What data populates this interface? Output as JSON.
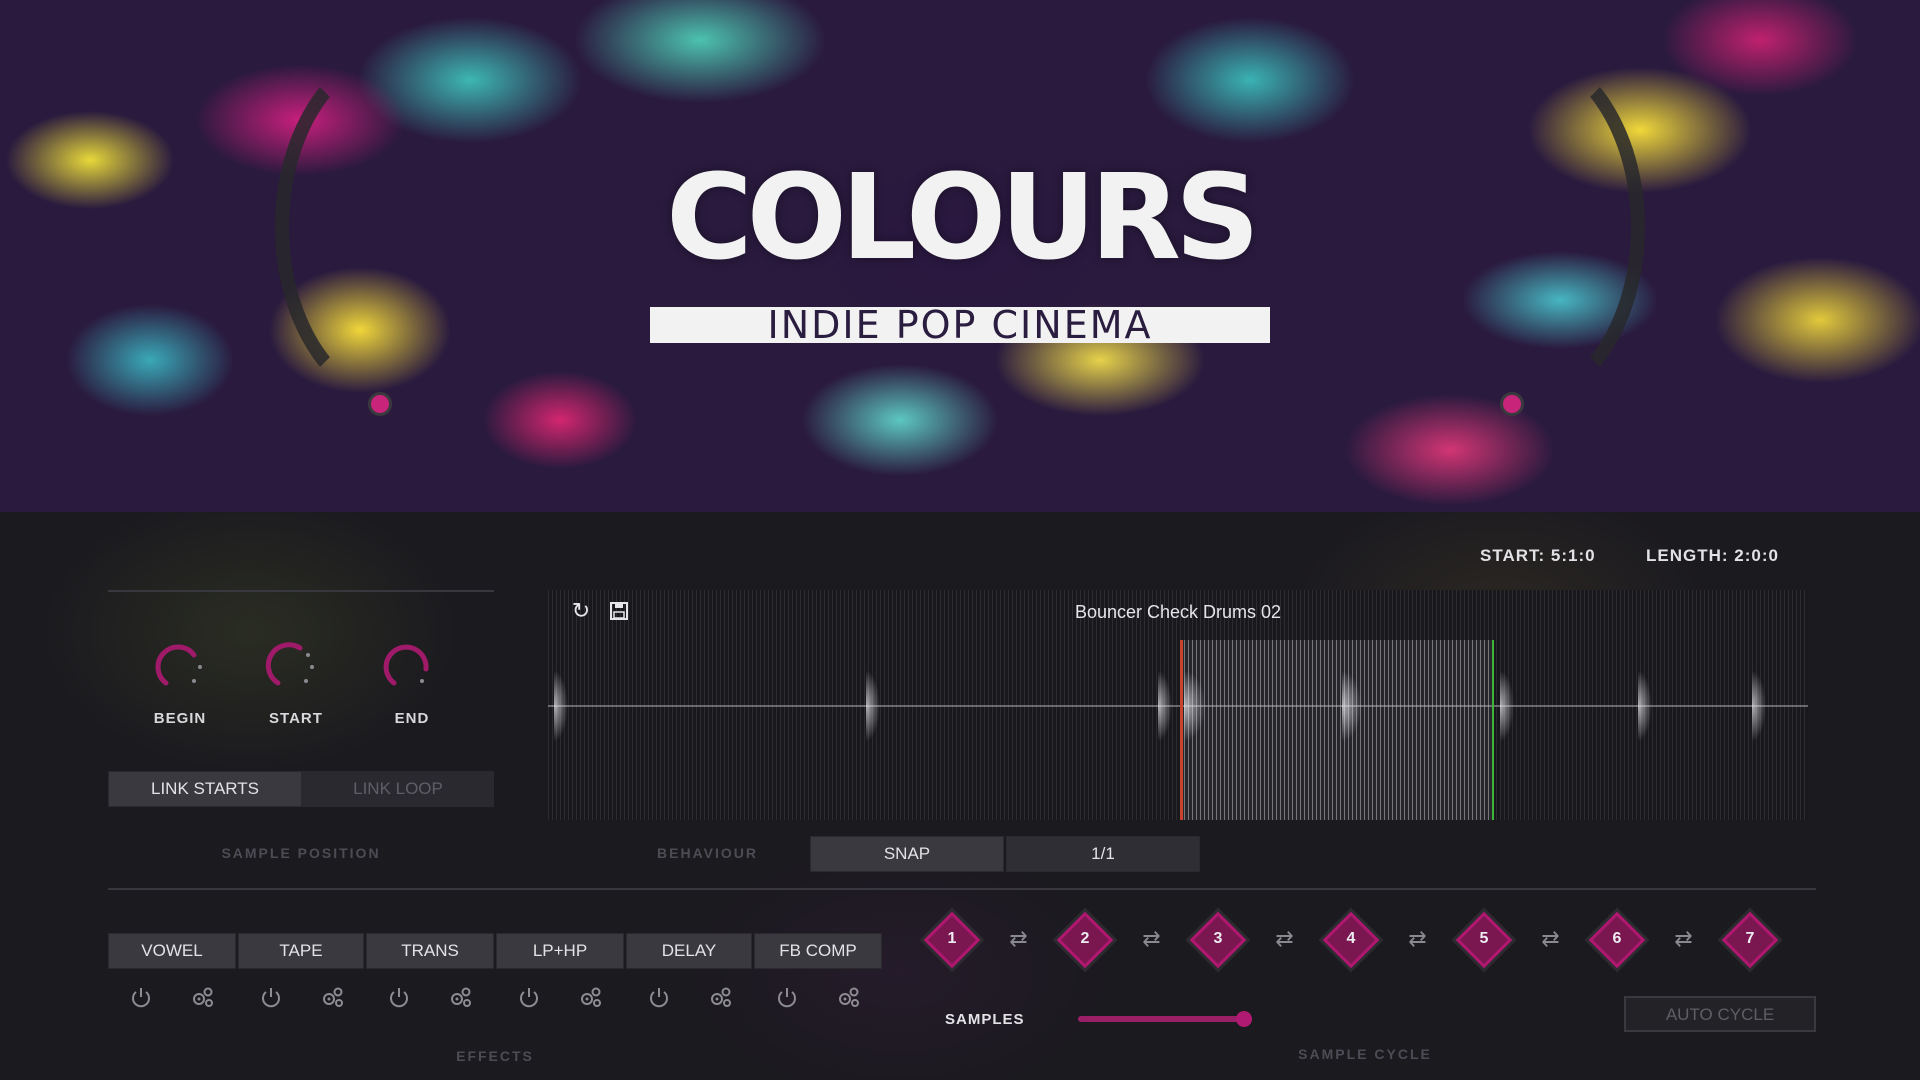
{
  "header": {
    "title": "COLOURS",
    "subtitle": "INDIE POP CINEMA"
  },
  "readout": {
    "start": "START: 5:1:0",
    "length": "LENGTH: 2:0:0"
  },
  "sample_position": {
    "knobs": [
      {
        "label": "BEGIN",
        "value": 0.25
      },
      {
        "label": "START",
        "value": 0.35
      },
      {
        "label": "END",
        "value": 0.55
      }
    ],
    "link_starts_label": "LINK STARTS",
    "link_loop_label": "LINK LOOP",
    "section_label": "SAMPLE POSITION"
  },
  "waveform": {
    "sample_name": "Bouncer Check Drums 02",
    "refresh_icon": "refresh-icon",
    "save_icon": "save-icon"
  },
  "behaviour": {
    "label": "BEHAVIOUR",
    "snap_label": "SNAP",
    "division": "1/1"
  },
  "effects": {
    "section_label": "EFFECTS",
    "items": [
      "VOWEL",
      "TAPE",
      "TRANS",
      "LP+HP",
      "DELAY",
      "FB COMP"
    ],
    "power_icon": "power-icon",
    "settings_icon": "gears-icon"
  },
  "sample_cycle": {
    "section_label": "SAMPLE CYCLE",
    "slots": [
      "1",
      "2",
      "3",
      "4",
      "5",
      "6",
      "7"
    ],
    "samples_label": "SAMPLES",
    "samples_value": 0.9,
    "auto_cycle_label": "AUTO CYCLE"
  },
  "colors": {
    "accent": "#b0176f",
    "start_marker": "#c8432e",
    "end_marker": "#3fb63a"
  }
}
